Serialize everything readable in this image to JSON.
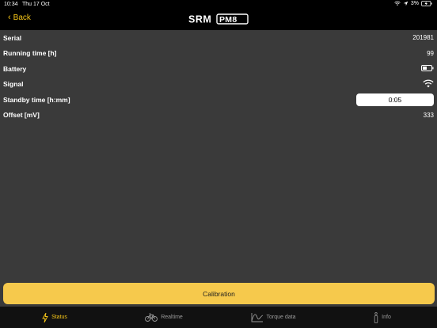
{
  "status_bar": {
    "time": "10:34",
    "date": "Thu 17 Oct",
    "battery_percent": "3%"
  },
  "nav": {
    "back_label": "Back",
    "logo_text": "SRM PM8"
  },
  "rows": [
    {
      "label": "Serial",
      "value": "201981"
    },
    {
      "label": "Running time [h]",
      "value": "99"
    },
    {
      "label": "Battery",
      "icon": "battery-low-icon"
    },
    {
      "label": "Signal",
      "icon": "wifi-signal-icon"
    },
    {
      "label": "Standby time [h:mm]",
      "value": "0:05"
    },
    {
      "label": "Offset [mV]",
      "value": "333"
    }
  ],
  "calibration_label": "Calibration",
  "tabs": [
    {
      "label": "Status",
      "icon": "lightning-icon",
      "active": true
    },
    {
      "label": "Realtime",
      "icon": "bicycle-icon",
      "active": false
    },
    {
      "label": "Torque data",
      "icon": "torque-curve-icon",
      "active": false
    },
    {
      "label": "Info",
      "icon": "info-icon",
      "active": false
    }
  ],
  "colors": {
    "accent": "#f5c518",
    "button": "#f6c94c",
    "background": "#3a3a3a",
    "bar": "#000000"
  }
}
